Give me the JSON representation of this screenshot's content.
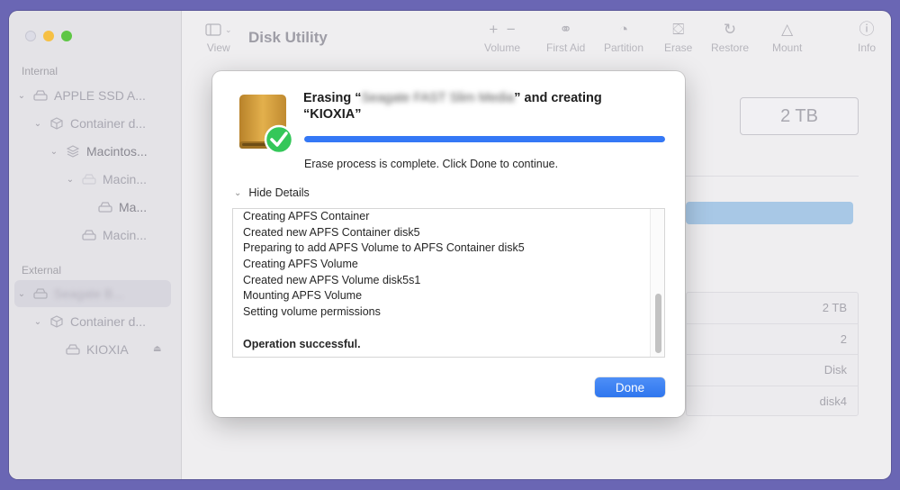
{
  "window": {
    "title": "Disk Utility"
  },
  "toolbar": {
    "view_label": "View",
    "volume_label": "Volume",
    "first_aid_label": "First Aid",
    "partition_label": "Partition",
    "erase_label": "Erase",
    "restore_label": "Restore",
    "mount_label": "Mount",
    "info_label": "Info"
  },
  "sidebar": {
    "internal_header": "Internal",
    "external_header": "External",
    "internal_items": [
      {
        "label": "APPLE SSD A..."
      },
      {
        "label": "Container d..."
      },
      {
        "label": "Macintos..."
      },
      {
        "label": "Macin..."
      },
      {
        "label": "Ma..."
      },
      {
        "label": "Macin..."
      }
    ],
    "external_items": [
      {
        "label": "Seagate B..."
      },
      {
        "label": "Container d..."
      },
      {
        "label": "KIOXIA"
      }
    ]
  },
  "content": {
    "capacity": "2 TB",
    "info_rows": [
      "2 TB",
      "2",
      "Disk",
      "disk4"
    ]
  },
  "dialog": {
    "title_prefix": "Erasing “",
    "title_redacted": "Seagate FAST Slim Media",
    "title_suffix": "” and creating “KIOXIA”",
    "progress": 1.0,
    "status": "Erase process is complete. Click Done to continue.",
    "details_toggle": "Hide Details",
    "log": [
      "Creating APFS Container",
      "Created new APFS Container disk5",
      "Preparing to add APFS Volume to APFS Container disk5",
      "Creating APFS Volume",
      "Created new APFS Volume disk5s1",
      "Mounting APFS Volume",
      "Setting volume permissions",
      "",
      "Operation successful."
    ],
    "done_label": "Done"
  },
  "colors": {
    "desktop": "#6a66b4",
    "accent": "#3478f6",
    "success_green": "#34c759",
    "drive_gold": "#d9a43a"
  }
}
